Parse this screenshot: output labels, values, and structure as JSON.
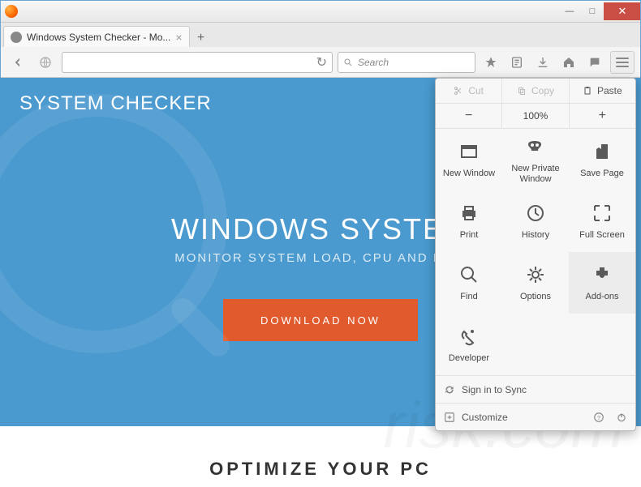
{
  "window": {
    "tab_title": "Windows System Checker - Mo...",
    "controls": {
      "min": "—",
      "max": "□",
      "close": "✕"
    }
  },
  "navbar": {
    "search_placeholder": "Search"
  },
  "toolbar_icons": [
    "bookmark-icon",
    "reader-icon",
    "downloads-icon",
    "home-icon",
    "chat-icon"
  ],
  "page": {
    "logo": "SYSTEM CHECKER",
    "title": "WINDOWS SYSTEM",
    "subtitle": "MONITOR SYSTEM LOAD, CPU AND MEM",
    "download": "DOWNLOAD NOW",
    "below": "OPTIMIZE YOUR PC"
  },
  "menu": {
    "edit": {
      "cut": "Cut",
      "copy": "Copy",
      "paste": "Paste"
    },
    "zoom": {
      "minus": "−",
      "value": "100%",
      "plus": "+"
    },
    "grid": [
      {
        "name": "new-window",
        "label": "New Window"
      },
      {
        "name": "new-private-window",
        "label": "New Private Window"
      },
      {
        "name": "save-page",
        "label": "Save Page"
      },
      {
        "name": "print",
        "label": "Print"
      },
      {
        "name": "history",
        "label": "History"
      },
      {
        "name": "full-screen",
        "label": "Full Screen"
      },
      {
        "name": "find",
        "label": "Find"
      },
      {
        "name": "options",
        "label": "Options"
      },
      {
        "name": "add-ons",
        "label": "Add-ons",
        "highlight": true
      },
      {
        "name": "developer",
        "label": "Developer"
      }
    ],
    "sync": "Sign in to Sync",
    "customize": "Customize"
  }
}
